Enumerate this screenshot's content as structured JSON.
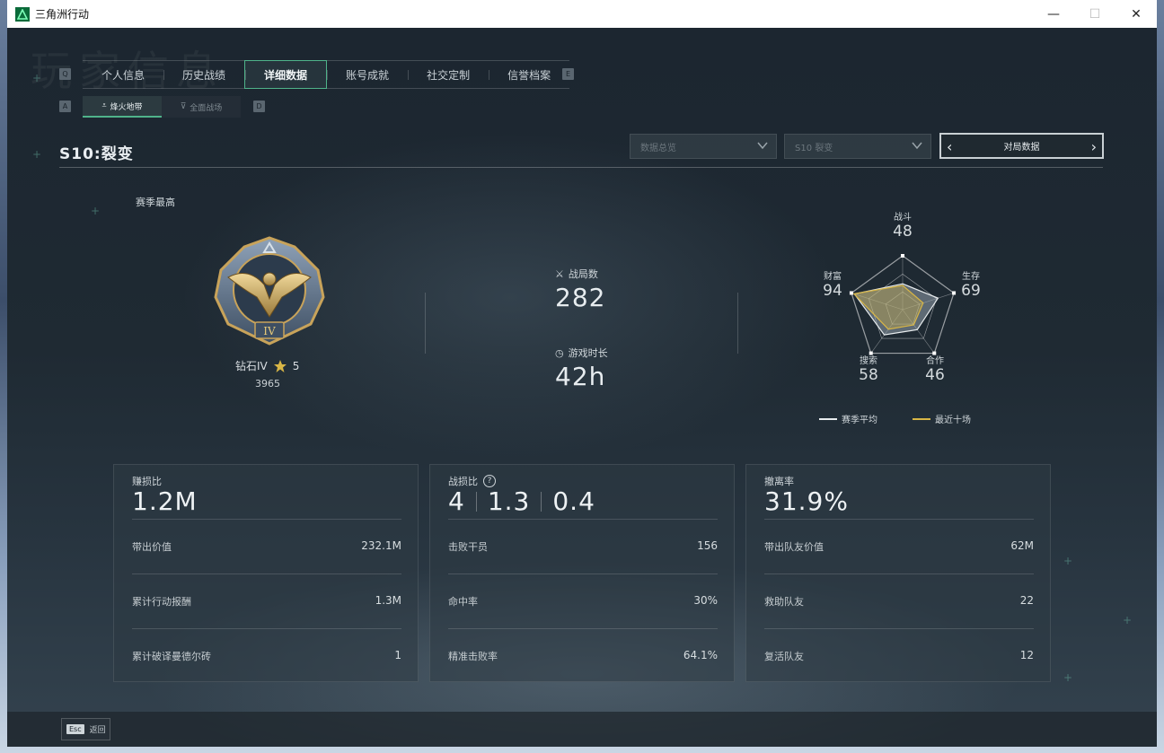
{
  "window": {
    "title": "三角洲行动",
    "minimize": "—",
    "maximize": "☐",
    "close": "✕"
  },
  "background_title": "玩家信息",
  "keys": {
    "prev_tab": "Q",
    "next_tab": "E",
    "prev_sub": "A",
    "next_sub": "D"
  },
  "tabs": [
    {
      "label": "个人信息",
      "active": false
    },
    {
      "label": "历史战绩",
      "active": false
    },
    {
      "label": "详细数据",
      "active": true
    },
    {
      "label": "账号成就",
      "active": false
    },
    {
      "label": "社交定制",
      "active": false
    },
    {
      "label": "信誉档案",
      "active": false
    }
  ],
  "subtabs": [
    {
      "label": "烽火地带",
      "active": true
    },
    {
      "label": "全面战场",
      "active": false
    }
  ],
  "season": {
    "title": "S10:裂变"
  },
  "filters": {
    "overview": "数据总览",
    "season": "S10 裂变",
    "pager_label": "对局数据"
  },
  "rank": {
    "season_best_label": "赛季最高",
    "badge_numeral": "IV",
    "name": "钻石IV",
    "stars": "5",
    "score": "3965"
  },
  "stats": {
    "matches_label": "战局数",
    "matches_value": "282",
    "playtime_label": "游戏时长",
    "playtime_value": "42h"
  },
  "radar": {
    "axes": [
      {
        "name": "战斗",
        "value": 48
      },
      {
        "name": "生存",
        "value": 69
      },
      {
        "name": "合作",
        "value": 46
      },
      {
        "name": "搜索",
        "value": 58
      },
      {
        "name": "财富",
        "value": 94
      }
    ],
    "recent_ten": [
      45,
      40,
      35,
      45,
      95
    ],
    "max": 100,
    "legend_season": "赛季平均",
    "legend_recent": "最近十场",
    "color_season": "#e8ecee",
    "color_recent": "#d8b646"
  },
  "cards": {
    "profit": {
      "title": "赚损比",
      "value": "1.2M",
      "rows": [
        {
          "k": "带出价值",
          "v": "232.1M"
        },
        {
          "k": "累计行动报酬",
          "v": "1.3M"
        },
        {
          "k": "累计破译曼德尔砖",
          "v": "1"
        }
      ]
    },
    "kd": {
      "title": "战损比",
      "help": "?",
      "values": [
        "4",
        "1.3",
        "0.4"
      ],
      "rows": [
        {
          "k": "击败干员",
          "v": "156"
        },
        {
          "k": "命中率",
          "v": "30%"
        },
        {
          "k": "精准击败率",
          "v": "64.1%"
        }
      ]
    },
    "extract": {
      "title": "撤离率",
      "value": "31.9%",
      "rows": [
        {
          "k": "带出队友价值",
          "v": "62M"
        },
        {
          "k": "救助队友",
          "v": "22"
        },
        {
          "k": "复活队友",
          "v": "12"
        }
      ]
    }
  },
  "footer": {
    "esc_key": "Esc",
    "back_label": "返回"
  },
  "colors": {
    "accent": "#4fb38a",
    "gold": "#d8b646"
  }
}
